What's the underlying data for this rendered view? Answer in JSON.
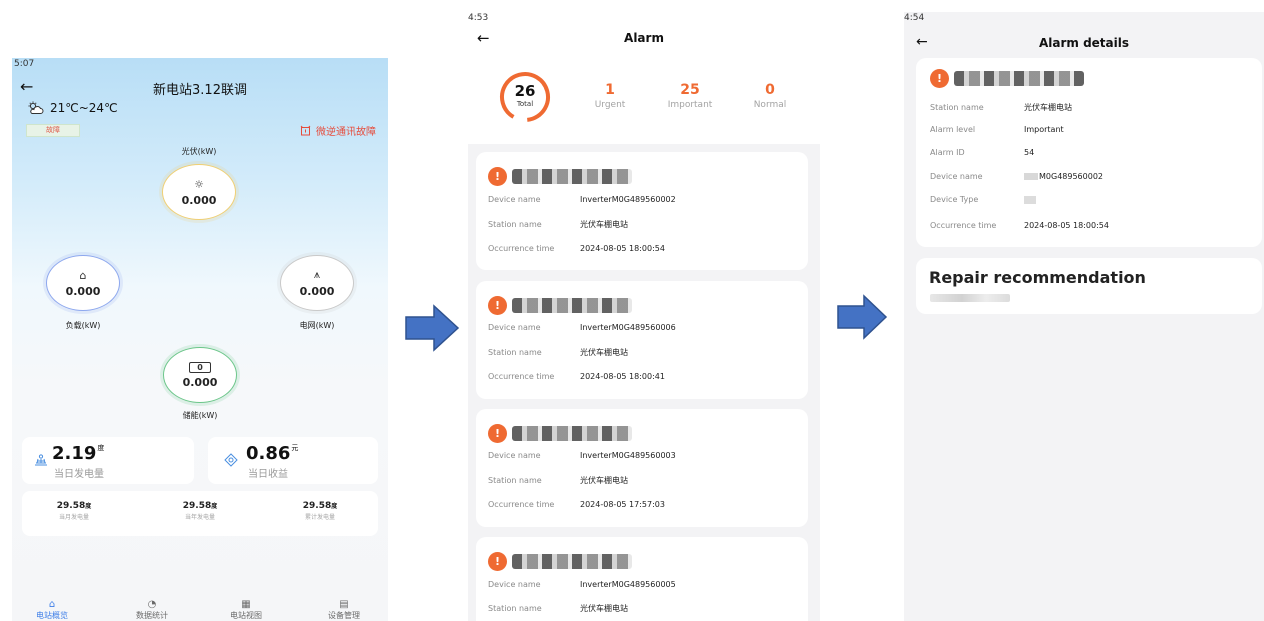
{
  "screen1": {
    "status_time": "5:07",
    "title": "新电站3.12联调",
    "weather": "21℃~24℃",
    "fault_badge": "故障",
    "alert_text": "微逆通讯故障",
    "nodes": {
      "pv": {
        "label": "光伏(kW)",
        "value": "0.000"
      },
      "load": {
        "label": "负载(kW)",
        "value": "0.000"
      },
      "grid": {
        "label": "电网(kW)",
        "value": "0.000"
      },
      "storage": {
        "label": "储能(kW)",
        "value": "0.000",
        "battery_value": "0"
      }
    },
    "daily_generation": {
      "value": "2.19",
      "unit": "度",
      "label": "当日发电量"
    },
    "daily_revenue": {
      "value": "0.86",
      "unit": "元",
      "label": "当日收益"
    },
    "totals": [
      {
        "value": "29.58",
        "unit": "度",
        "label": "当月发电量"
      },
      {
        "value": "29.58",
        "unit": "度",
        "label": "当年发电量"
      },
      {
        "value": "29.58",
        "unit": "度",
        "label": "累计发电量"
      }
    ],
    "bottom_nav": [
      {
        "label": "电站概览",
        "icon": "home-icon",
        "active": true
      },
      {
        "label": "数据统计",
        "icon": "pie-chart-icon",
        "active": false
      },
      {
        "label": "电站视图",
        "icon": "grid-icon",
        "active": false
      },
      {
        "label": "设备管理",
        "icon": "device-icon",
        "active": false
      }
    ]
  },
  "screen2": {
    "status_time": "4:53",
    "title": "Alarm",
    "summary": {
      "total": "26",
      "total_label": "Total",
      "urgent": "1",
      "urgent_label": "Urgent",
      "important": "25",
      "important_label": "Important",
      "normal": "0",
      "normal_label": "Normal"
    },
    "labels": {
      "device_name": "Device name",
      "station_name": "Station name",
      "occurrence_time": "Occurrence time"
    },
    "alarms": [
      {
        "device_name": "InverterM0G489560002",
        "station_name": "光伏车棚电站",
        "occurrence_time": "2024-08-05 18:00:54"
      },
      {
        "device_name": "InverterM0G489560006",
        "station_name": "光伏车棚电站",
        "occurrence_time": "2024-08-05 18:00:41"
      },
      {
        "device_name": "InverterM0G489560003",
        "station_name": "光伏车棚电站",
        "occurrence_time": "2024-08-05 17:57:03"
      },
      {
        "device_name": "InverterM0G489560005",
        "station_name": "光伏车棚电站"
      }
    ]
  },
  "screen3": {
    "status_time": "4:54",
    "title": "Alarm details",
    "fields": [
      {
        "label": "Station name",
        "value": "光伏车棚电站"
      },
      {
        "label": "Alarm level",
        "value": "Important"
      },
      {
        "label": "Alarm ID",
        "value": "54"
      },
      {
        "label": "Device name",
        "value": "M0G489560002"
      },
      {
        "label": "Device Type",
        "value": ""
      },
      {
        "label": "Occurrence time",
        "value": "2024-08-05 18:00:54"
      }
    ],
    "repair_title": "Repair recommendation"
  },
  "colors": {
    "accent_orange": "#ef6a32",
    "nav_active_blue": "#3f7fe8",
    "arrow_blue": "#4472c4",
    "alert_red": "#e64c3c"
  }
}
